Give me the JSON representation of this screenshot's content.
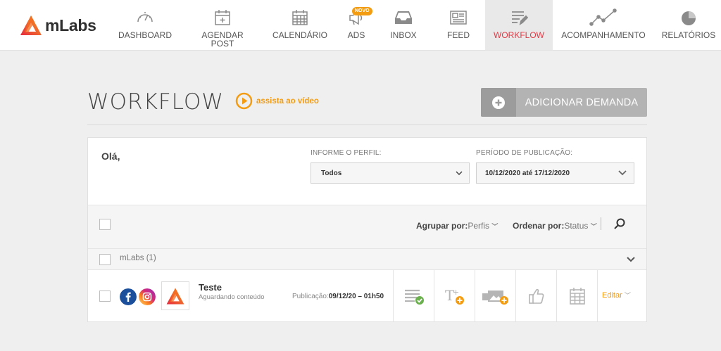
{
  "brand": {
    "name": "mLabs"
  },
  "nav": {
    "items": [
      {
        "label": "DASHBOARD",
        "icon": "gauge-icon"
      },
      {
        "label": "AGENDAR POST",
        "icon": "calendar-plus-icon"
      },
      {
        "label": "CALENDÁRIO",
        "icon": "calendar-icon"
      },
      {
        "label": "ADS",
        "icon": "megaphone-icon",
        "badge": "NOVO"
      },
      {
        "label": "INBOX",
        "icon": "inbox-icon"
      },
      {
        "label": "FEED",
        "icon": "newspaper-icon"
      },
      {
        "label": "WORKFLOW",
        "icon": "workflow-list-icon",
        "active": true
      },
      {
        "label": "ACOMPANHAMENTO",
        "icon": "line-chart-icon"
      },
      {
        "label": "RELATÓRIOS",
        "icon": "pie-chart-icon"
      }
    ]
  },
  "page": {
    "title": "WORKFLOW",
    "video_link": "assista ao vídeo",
    "add_button": "ADICIONAR DEMANDA"
  },
  "filters": {
    "greeting": "Olá,",
    "profile_label": "INFORME O PERFIL:",
    "profile_value": "Todos",
    "period_label": "PERÍODO DE PUBLICAÇÃO:",
    "period_value": "10/12/2020 até 17/12/2020"
  },
  "toolbar": {
    "group_label": "Agrupar por:",
    "group_value": "Perfis",
    "order_label": "Ordenar por:",
    "order_value": "Status"
  },
  "group": {
    "label": "mLabs (1)"
  },
  "items": [
    {
      "title": "Teste",
      "status": "Aguardando conteúdo",
      "pub_label": "Publicação:",
      "pub_value": "09/12/20 – 01h50",
      "edit": "Editar"
    }
  ],
  "colors": {
    "accent_orange": "#f39c12",
    "active_red": "#e33a45",
    "facebook": "#1b4f9c",
    "instagram": "#d62976",
    "done_green": "#6ab04c"
  }
}
